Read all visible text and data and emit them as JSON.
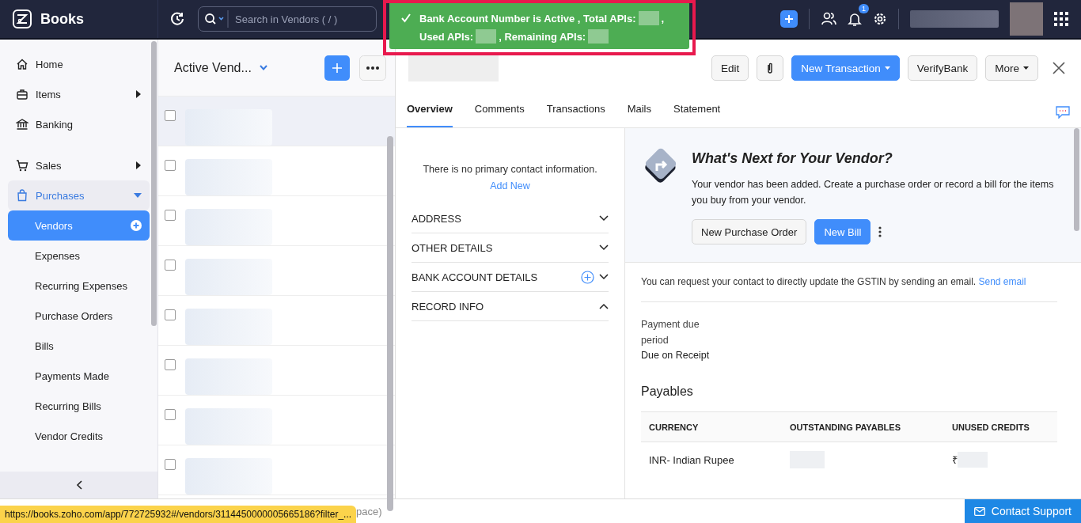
{
  "app": {
    "name": "Books"
  },
  "search": {
    "placeholder": "Search in Vendors ( / )"
  },
  "topbar": {
    "notification_count": "1"
  },
  "toast": {
    "lines": [
      [
        {
          "kind": "text",
          "text": "Bank Account Number is Active , Total APIs:"
        },
        {
          "kind": "redacted"
        },
        {
          "kind": "text",
          "text": ","
        }
      ],
      [
        {
          "kind": "text",
          "text": "Used APIs:"
        },
        {
          "kind": "redacted"
        },
        {
          "kind": "text",
          "text": ", Remaining APIs:"
        },
        {
          "kind": "redacted"
        }
      ]
    ]
  },
  "sidebar": {
    "items": [
      {
        "label": "Home",
        "kind": "link",
        "selected": false
      },
      {
        "label": "Items",
        "kind": "menu",
        "selected": false
      },
      {
        "label": "Banking",
        "kind": "link",
        "selected": false
      },
      {
        "label": "Sales",
        "kind": "menu",
        "selected": false
      },
      {
        "label": "Purchases",
        "kind": "group",
        "selected": false,
        "expanded": true,
        "children": [
          {
            "label": "Vendors",
            "selected": true
          },
          {
            "label": "Expenses",
            "selected": false
          },
          {
            "label": "Recurring Expenses",
            "selected": false
          },
          {
            "label": "Purchase Orders",
            "selected": false
          },
          {
            "label": "Bills",
            "selected": false
          },
          {
            "label": "Payments Made",
            "selected": false
          },
          {
            "label": "Recurring Bills",
            "selected": false
          },
          {
            "label": "Vendor Credits",
            "selected": false
          }
        ]
      }
    ]
  },
  "list": {
    "title": "Active Vend...",
    "rows": [
      {
        "selected": true,
        "checked": false
      },
      {
        "selected": false,
        "checked": false
      },
      {
        "selected": false,
        "checked": false
      },
      {
        "selected": false,
        "checked": false
      },
      {
        "selected": false,
        "checked": false
      },
      {
        "selected": false,
        "checked": false
      },
      {
        "selected": false,
        "checked": false
      },
      {
        "selected": false,
        "checked": false
      }
    ]
  },
  "detail": {
    "buttons": [
      {
        "kind": "plain",
        "label": "Edit"
      },
      {
        "kind": "attach"
      },
      {
        "kind": "primary",
        "label": "New Transaction",
        "caret": true
      },
      {
        "kind": "plain",
        "label": "VerifyBank"
      },
      {
        "kind": "plain",
        "label": "More",
        "caret": true
      }
    ],
    "tabs": [
      {
        "label": "Overview",
        "selected": true
      },
      {
        "label": "Comments",
        "selected": false
      },
      {
        "label": "Transactions",
        "selected": false
      },
      {
        "label": "Mails",
        "selected": false
      },
      {
        "label": "Statement",
        "selected": false
      }
    ],
    "contact": {
      "message": "There is no primary contact information.",
      "link": "Add New"
    },
    "sections": [
      {
        "label": "ADDRESS",
        "expanded": false,
        "add": false
      },
      {
        "label": "OTHER DETAILS",
        "expanded": false,
        "add": false
      },
      {
        "label": "BANK ACCOUNT DETAILS",
        "expanded": false,
        "add": true
      },
      {
        "label": "RECORD INFO",
        "expanded": true,
        "add": false
      }
    ],
    "next": {
      "title": "What's Next for Your Vendor?",
      "text": "Your vendor has been added. Create a purchase order or record a bill for the items you buy from your vendor.",
      "buttons": [
        {
          "kind": "plain",
          "label": "New Purchase Order"
        },
        {
          "kind": "primary",
          "label": "New Bill"
        }
      ]
    },
    "gstin": {
      "text": "You can request your contact to directly update the GSTIN by sending an email.",
      "link": "Send email"
    },
    "payment": {
      "label": "Payment due period",
      "value": "Due on Receipt"
    },
    "payables": {
      "title": "Payables",
      "columns": [
        "CURRENCY",
        "OUTSTANDING PAYABLES",
        "UNUSED CREDITS"
      ],
      "rows": [
        {
          "currency": "INR- Indian Rupee",
          "credit_symbol": "₹"
        }
      ]
    }
  },
  "footer": {
    "text": "pace)"
  },
  "url_tooltip": {
    "text": "https://books.zoho.com/app/772725932#/vendors/3114450000005665186?filter_..."
  },
  "support": {
    "label": "Contact Support"
  }
}
